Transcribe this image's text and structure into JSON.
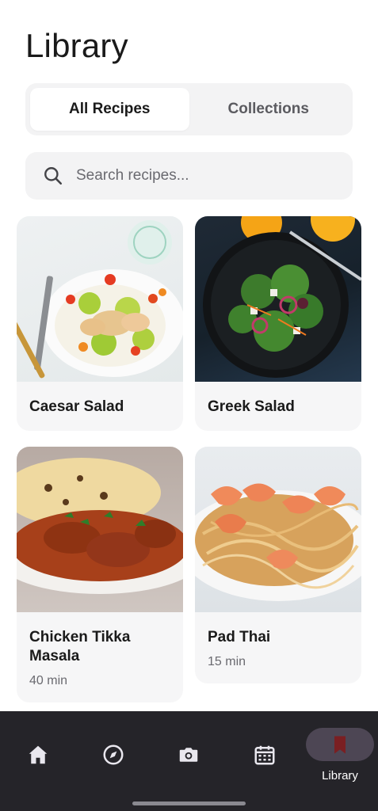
{
  "page": {
    "title": "Library"
  },
  "tabs": [
    {
      "label": "All Recipes",
      "active": true
    },
    {
      "label": "Collections",
      "active": false
    }
  ],
  "search": {
    "placeholder": "Search recipes...",
    "value": ""
  },
  "recipes": [
    {
      "name": "Caesar Salad",
      "time": ""
    },
    {
      "name": "Greek Salad",
      "time": ""
    },
    {
      "name": "Chicken Tikka Masala",
      "time": "40 min"
    },
    {
      "name": "Pad Thai",
      "time": "15 min"
    }
  ],
  "bottom_nav": [
    {
      "icon": "home-icon",
      "label": ""
    },
    {
      "icon": "compass-icon",
      "label": ""
    },
    {
      "icon": "camera-icon",
      "label": ""
    },
    {
      "icon": "calendar-icon",
      "label": ""
    },
    {
      "icon": "bookmark-icon",
      "label": "Library",
      "active": true
    }
  ],
  "colors": {
    "nav_background": "#252429",
    "active_pill": "#4d4654",
    "bookmark_active": "#7a1f22",
    "surface": "#f3f3f4"
  }
}
